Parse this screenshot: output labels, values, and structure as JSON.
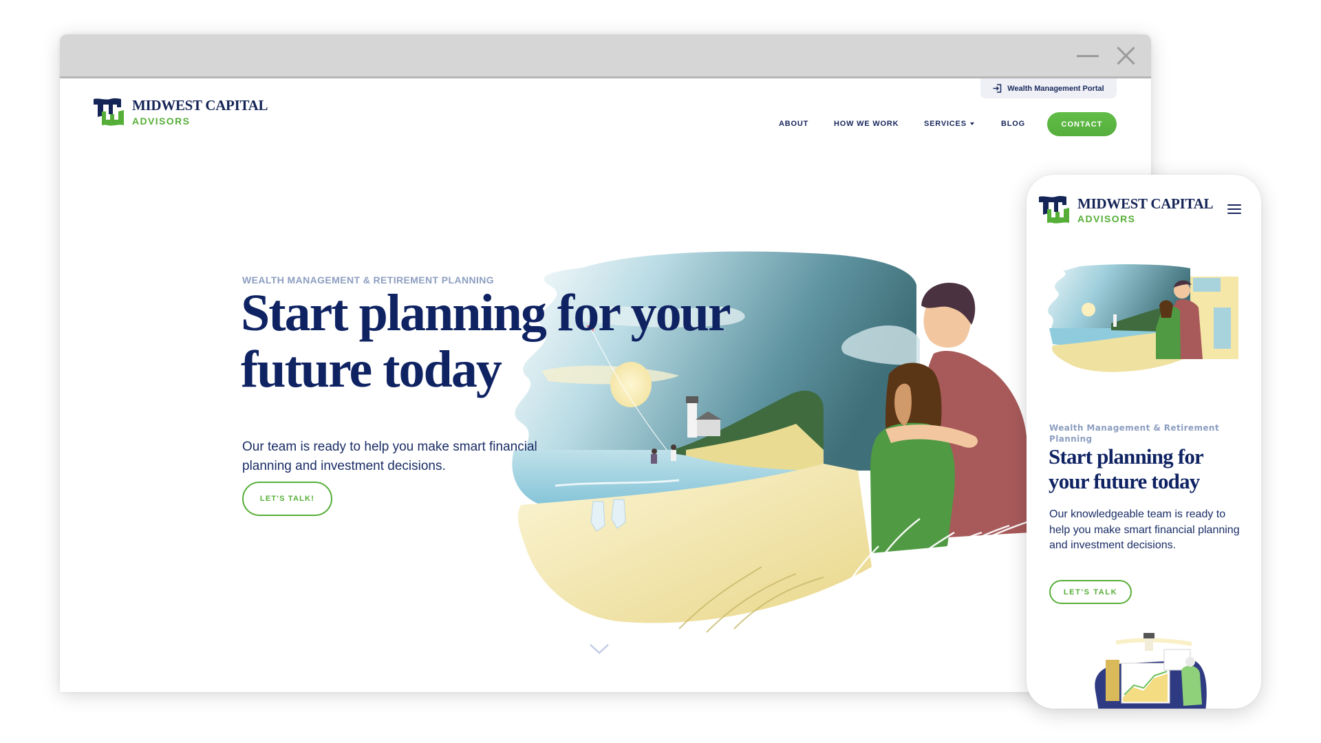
{
  "window": {
    "controls": [
      "minimize-icon",
      "close-icon"
    ]
  },
  "brand": {
    "name": "MIDWEST CAPITAL",
    "sub": "ADVISORS",
    "navy": "#142456",
    "green": "#55ae37"
  },
  "desktop": {
    "portal": {
      "icon": "login-icon",
      "label": "Wealth Management Portal"
    },
    "nav": {
      "items": [
        {
          "label": "ABOUT"
        },
        {
          "label": "HOW WE WORK"
        },
        {
          "label": "SERVICES"
        },
        {
          "label": "BLOG"
        }
      ],
      "services_icon": "caret-down-icon",
      "contact_label": "CONTACT"
    },
    "hero": {
      "eyebrow": "WEALTH MANAGEMENT & RETIREMENT PLANNING",
      "title": "Start planning for your future today",
      "text": "Our team is ready to help you make smart financial planning and investment decisions.",
      "cta_label": "LET'S TALK!",
      "illustration": "couple-looking-at-beach-with-lighthouse-illustration",
      "scroll_icon": "chevron-down-icon"
    }
  },
  "mobile": {
    "menu_icon": "hamburger-menu-icon",
    "hero": {
      "eyebrow": "Wealth Management & Retirement Planning",
      "title": "Start planning for your future today",
      "text": "Our knowledgeable team is ready to help you make smart financial planning and investment decisions.",
      "cta_label": "LET'S TALK",
      "illustration": "couple-looking-at-beach-with-lighthouse-illustration",
      "secondary_illustration": "advisor-reviewing-charts-illustration"
    }
  }
}
